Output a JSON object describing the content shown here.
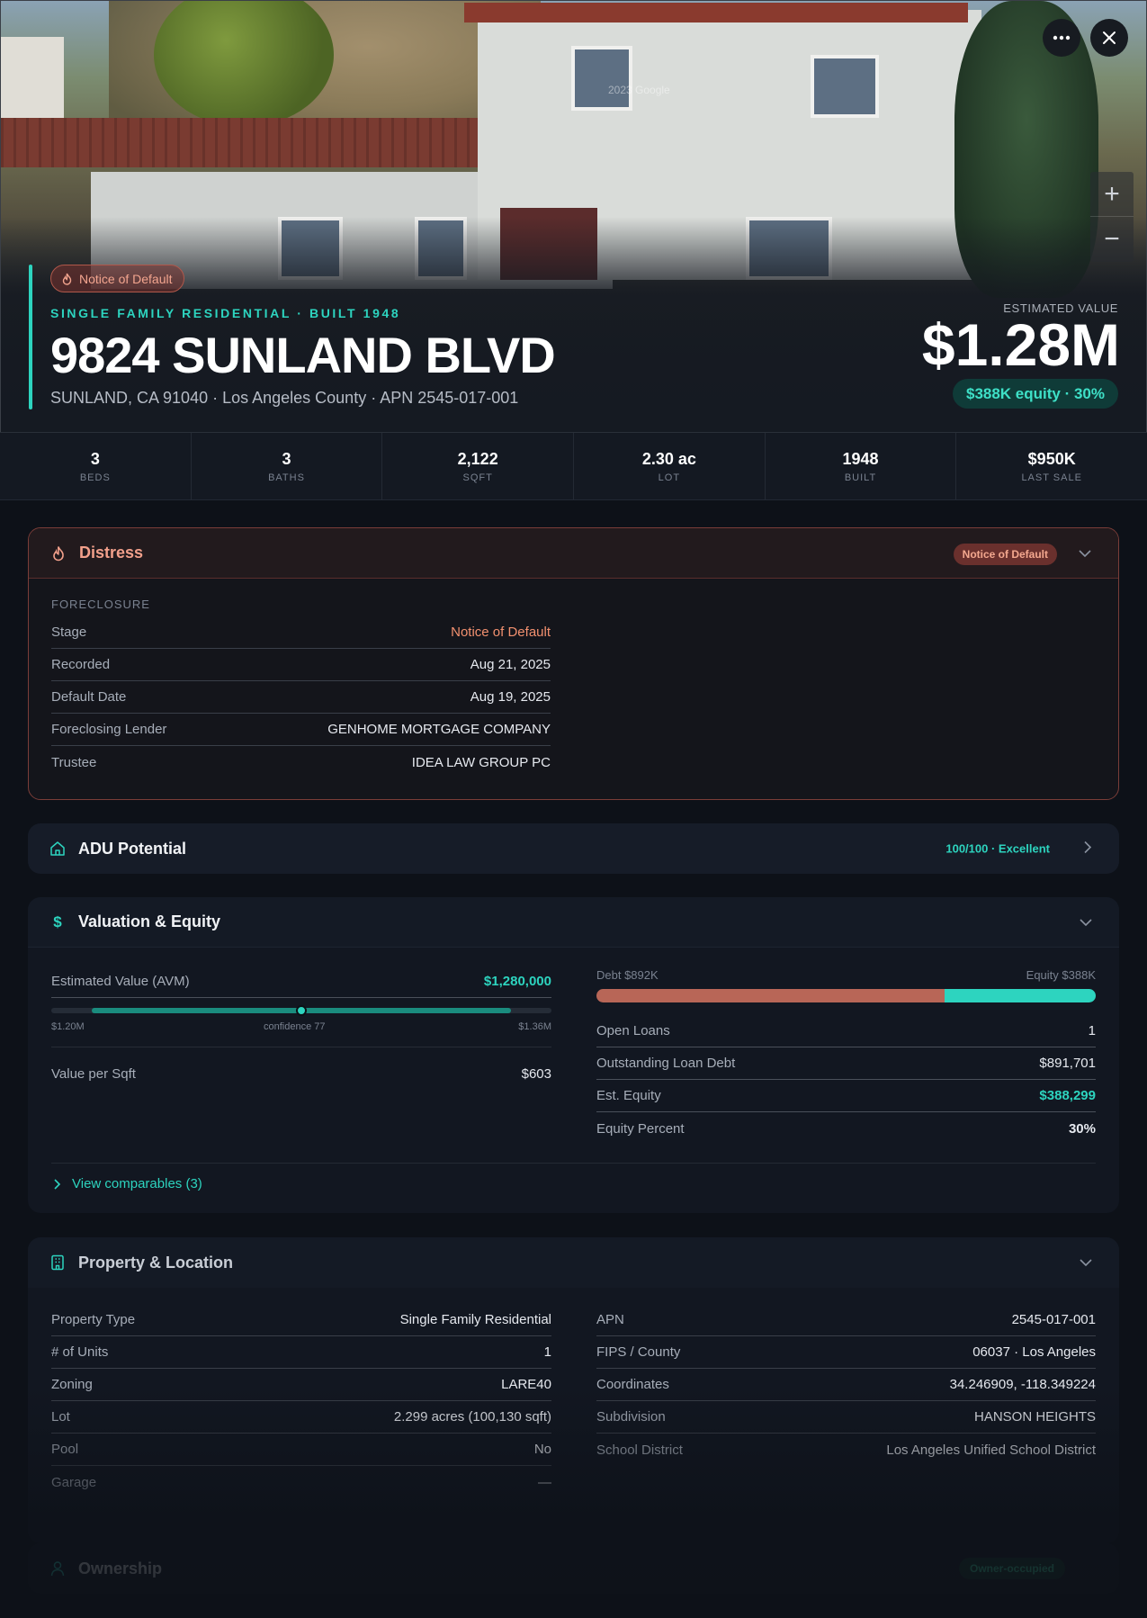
{
  "hero": {
    "badge": "Notice of Default",
    "subtitle": "SINGLE FAMILY RESIDENTIAL · BUILT 1948",
    "address": "9824 SUNLAND BLVD",
    "subaddress": "SUNLAND, CA 91040 · Los Angeles County · APN 2545-017-001",
    "estimated_label": "ESTIMATED VALUE",
    "estimated_value": "$1.28M",
    "equity_pill": "$388K equity · 30%",
    "photo_watermark": "2023 Google",
    "more_icon": "ellipsis-icon",
    "close_icon": "close-icon",
    "zoom_in": "+",
    "zoom_out": "−"
  },
  "stats": [
    {
      "value": "3",
      "label": "BEDS"
    },
    {
      "value": "3",
      "label": "BATHS"
    },
    {
      "value": "2,122",
      "label": "SQFT"
    },
    {
      "value": "2.30 ac",
      "label": "LOT"
    },
    {
      "value": "1948",
      "label": "BUILT"
    },
    {
      "value": "$950K",
      "label": "LAST SALE"
    }
  ],
  "distress": {
    "title": "Distress",
    "badge": "Notice of Default",
    "section": "FORECLOSURE",
    "rows": [
      {
        "k": "Stage",
        "v": "Notice of Default"
      },
      {
        "k": "Recorded",
        "v": "Aug 21, 2025"
      },
      {
        "k": "Default Date",
        "v": "Aug 19, 2025"
      },
      {
        "k": "Foreclosing Lender",
        "v": "GENHOME MORTGAGE COMPANY"
      },
      {
        "k": "Trustee",
        "v": "IDEA LAW GROUP PC"
      }
    ]
  },
  "adu": {
    "title": "ADU Potential",
    "score": "100/100 · Excellent"
  },
  "valuation": {
    "title": "Valuation & Equity",
    "avm_label": "Estimated Value (AVM)",
    "avm_value": "$1,280,000",
    "range_low": "$1.20M",
    "confidence": "confidence 77",
    "range_high": "$1.36M",
    "confidence_position": 0.5,
    "vps_label": "Value per Sqft",
    "vps_value": "$603",
    "debt_label": "Debt $892K",
    "equity_label": "Equity $388K",
    "debt_fraction": 0.697,
    "rows": [
      {
        "k": "Open Loans",
        "v": "1"
      },
      {
        "k": "Outstanding Loan Debt",
        "v": "$891,701"
      },
      {
        "k": "Est. Equity",
        "v": "$388,299"
      },
      {
        "k": "Equity Percent",
        "v": "30%"
      }
    ],
    "comparables": "View comparables (3)"
  },
  "property": {
    "title": "Property & Location",
    "left": [
      {
        "k": "Property Type",
        "v": "Single Family Residential"
      },
      {
        "k": "# of Units",
        "v": "1"
      },
      {
        "k": "Zoning",
        "v": "LARE40"
      },
      {
        "k": "Lot",
        "v": "2.299 acres (100,130 sqft)"
      },
      {
        "k": "Pool",
        "v": "No"
      },
      {
        "k": "Garage",
        "v": "—"
      }
    ],
    "right": [
      {
        "k": "APN",
        "v": "2545-017-001"
      },
      {
        "k": "FIPS / County",
        "v": "06037 · Los Angeles"
      },
      {
        "k": "Coordinates",
        "v": "34.246909, -118.349224"
      },
      {
        "k": "Subdivision",
        "v": "HANSON HEIGHTS"
      },
      {
        "k": "School District",
        "v": "Los Angeles Unified School District"
      }
    ]
  },
  "ownership": {
    "title": "Ownership",
    "badge": "Owner-occupied"
  },
  "colors": {
    "accent": "#2dd4bf",
    "distress": "#f2a08b",
    "debt": "#b86657"
  }
}
